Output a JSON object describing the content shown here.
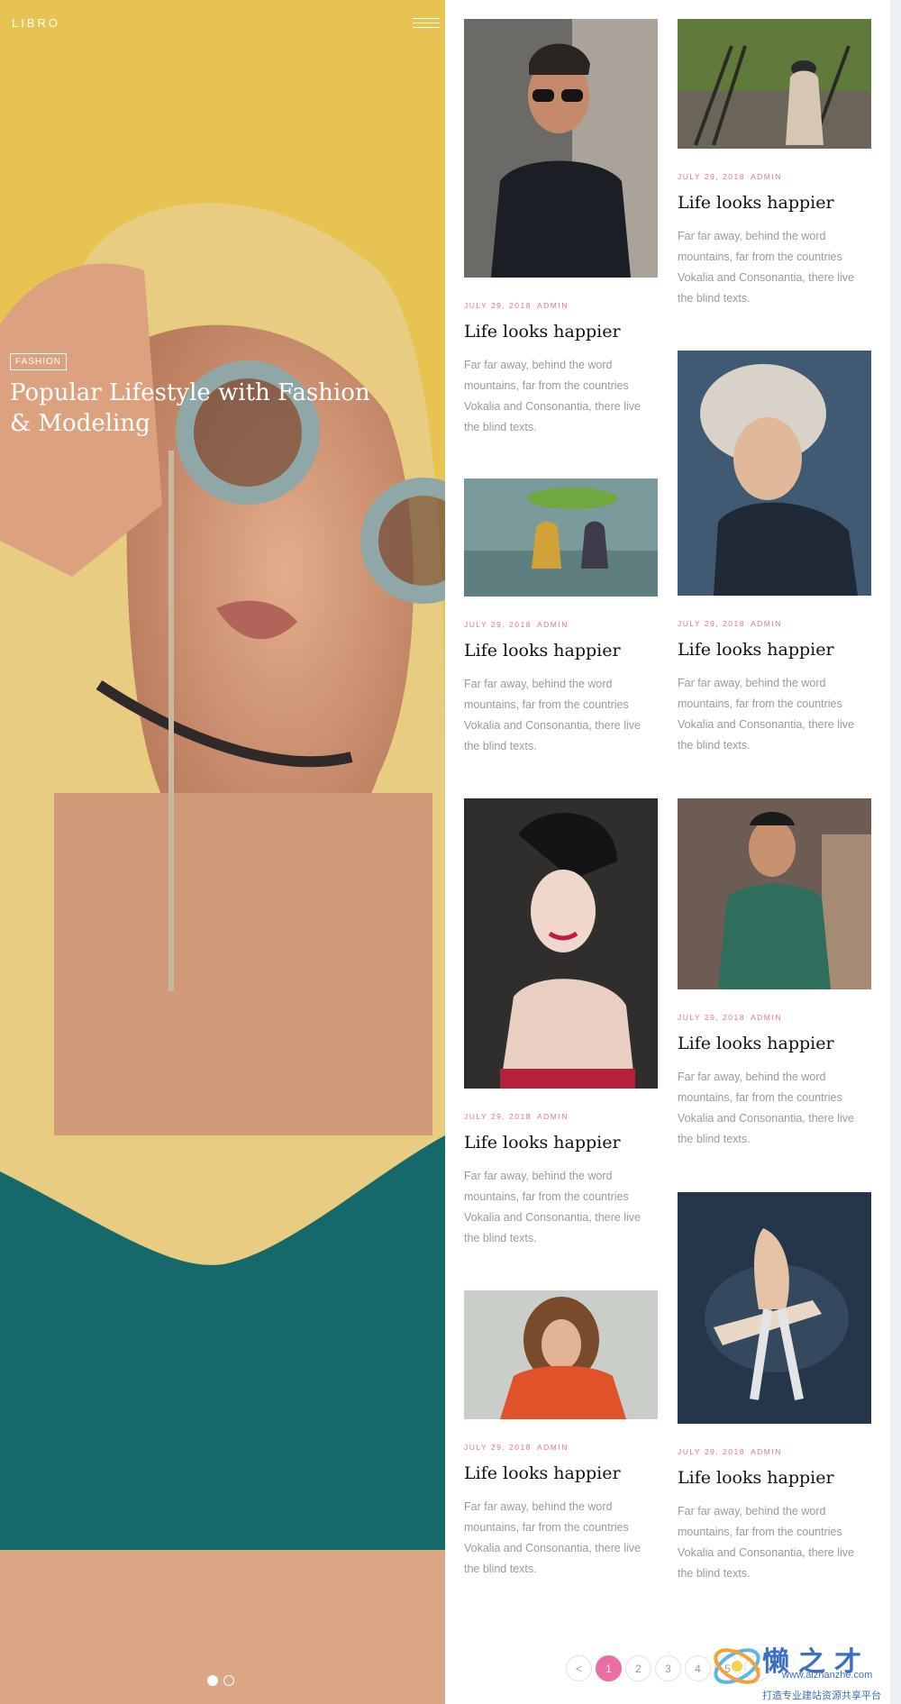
{
  "brand": "LIBRO",
  "hero": {
    "tag": "FASHION",
    "title": "Popular Lifestyle with Fashion & Modeling",
    "slides": 2,
    "active_slide": 1
  },
  "posts": [
    {
      "date": "JULY 29, 2018",
      "author": "ADMIN",
      "title": "Life looks happier",
      "excerpt": "Far far away, behind the word mountains, far from the countries Vokalia and Consonantia, there live the blind texts.",
      "image": "man-sunglasses-black-tee"
    },
    {
      "date": "JULY 29, 2018",
      "author": "ADMIN",
      "title": "Life looks happier",
      "excerpt": "Far far away, behind the word mountains, far from the countries Vokalia and Consonantia, there live the blind texts.",
      "image": "woman-walking-park-stairs"
    },
    {
      "date": "JULY 29, 2018",
      "author": "ADMIN",
      "title": "Life looks happier",
      "excerpt": "Far far away, behind the word mountains, far from the countries Vokalia and Consonantia, there live the blind texts.",
      "image": "children-in-water-leaf-umbrella"
    },
    {
      "date": "JULY 29, 2018",
      "author": "ADMIN",
      "title": "Life looks happier",
      "excerpt": "Far far away, behind the word mountains, far from the countries Vokalia and Consonantia, there live the blind texts.",
      "image": "woman-fur-hood"
    },
    {
      "date": "JULY 29, 2018",
      "author": "ADMIN",
      "title": "Life looks happier",
      "excerpt": "Far far away, behind the word mountains, far from the countries Vokalia and Consonantia, there live the blind texts.",
      "image": "woman-black-headpiece"
    },
    {
      "date": "JULY 29, 2018",
      "author": "ADMIN",
      "title": "Life looks happier",
      "excerpt": "Far far away, behind the word mountains, far from the countries Vokalia and Consonantia, there live the blind texts.",
      "image": "man-cap-glasses-street"
    },
    {
      "date": "JULY 29, 2018",
      "author": "ADMIN",
      "title": "Life looks happier",
      "excerpt": "Far far away, behind the word mountains, far from the countries Vokalia and Consonantia, there live the blind texts.",
      "image": "woman-curly-hair-orange-coat"
    },
    {
      "date": "JULY 29, 2018",
      "author": "ADMIN",
      "title": "Life looks happier",
      "excerpt": "Far far away, behind the word mountains, far from the countries Vokalia and Consonantia, there live the blind texts.",
      "image": "dancers-ballet"
    }
  ],
  "pagination": {
    "prev": "<",
    "pages": [
      "1",
      "2",
      "3",
      "4",
      "5"
    ],
    "active": "1",
    "next": ">"
  },
  "watermark": {
    "text": "懒之才",
    "url": "www.aizhanzhe.com",
    "subtitle": "打造专业建站资源共享平台"
  },
  "colors": {
    "accent": "#e96ea3",
    "meta_text": "#e96ea3",
    "body_text": "#9a9a9a",
    "title_text": "#111111"
  }
}
